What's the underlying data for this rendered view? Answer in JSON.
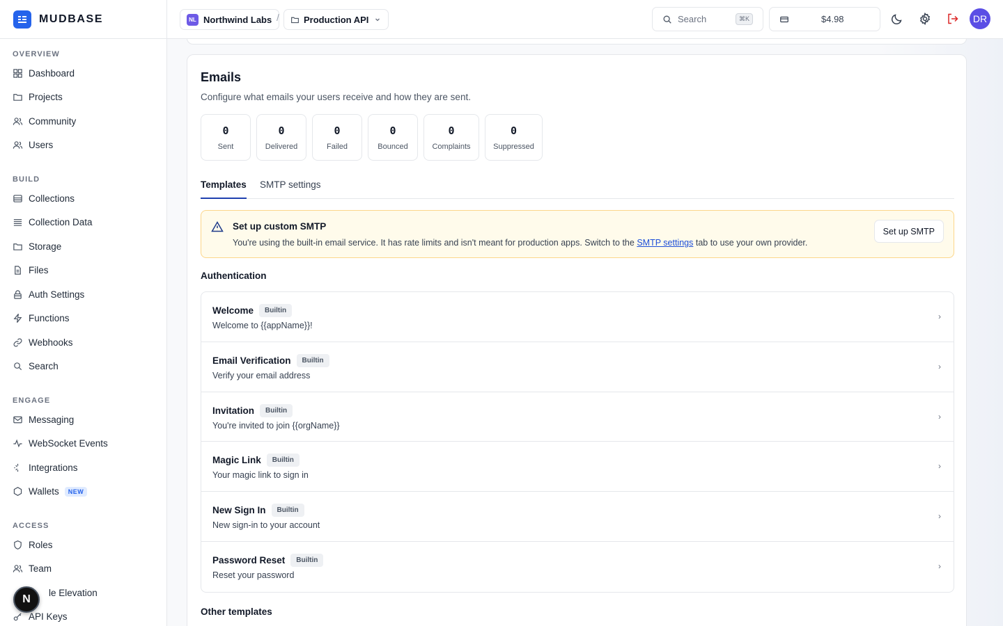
{
  "brand": {
    "name": "MUDBASE"
  },
  "sidebar": {
    "sections": [
      {
        "heading": "OVERVIEW",
        "items": [
          {
            "label": "Dashboard",
            "icon": "grid-icon"
          },
          {
            "label": "Projects",
            "icon": "folder-icon"
          },
          {
            "label": "Community",
            "icon": "users-icon"
          },
          {
            "label": "Users",
            "icon": "users-icon"
          }
        ]
      },
      {
        "heading": "BUILD",
        "items": [
          {
            "label": "Collections",
            "icon": "database-icon"
          },
          {
            "label": "Collection Data",
            "icon": "list-icon"
          },
          {
            "label": "Storage",
            "icon": "folder-icon"
          },
          {
            "label": "Files",
            "icon": "file-icon"
          },
          {
            "label": "Auth Settings",
            "icon": "lock-icon"
          },
          {
            "label": "Functions",
            "icon": "bolt-icon"
          },
          {
            "label": "Webhooks",
            "icon": "link-icon"
          },
          {
            "label": "Search",
            "icon": "search-icon"
          }
        ]
      },
      {
        "heading": "ENGAGE",
        "items": [
          {
            "label": "Messaging",
            "icon": "mail-icon"
          },
          {
            "label": "WebSocket Events",
            "icon": "activity-icon"
          },
          {
            "label": "Integrations",
            "icon": "sparkle-icon"
          },
          {
            "label": "Wallets",
            "icon": "hexagon-icon",
            "badge": "NEW"
          }
        ]
      },
      {
        "heading": "ACCESS",
        "items": [
          {
            "label": "Roles",
            "icon": "shield-icon"
          },
          {
            "label": "Team",
            "icon": "users-icon"
          },
          {
            "label": "le Elevation",
            "icon": "user-up-icon"
          },
          {
            "label": "API Keys",
            "icon": "key-icon"
          }
        ]
      }
    ],
    "fab_label": "N"
  },
  "topbar": {
    "org": {
      "initials": "NL",
      "name": "Northwind Labs"
    },
    "separator": "/",
    "project": {
      "name": "Production API"
    },
    "search": {
      "placeholder": "Search",
      "shortcut": "⌘K"
    },
    "credits": "$4.98",
    "avatar_initials": "DR"
  },
  "emails": {
    "title": "Emails",
    "subtitle": "Configure what emails your users receive and how they are sent.",
    "stats": [
      {
        "value": "0",
        "label": "Sent"
      },
      {
        "value": "0",
        "label": "Delivered"
      },
      {
        "value": "0",
        "label": "Failed"
      },
      {
        "value": "0",
        "label": "Bounced"
      },
      {
        "value": "0",
        "label": "Complaints"
      },
      {
        "value": "0",
        "label": "Suppressed"
      }
    ],
    "tabs": [
      {
        "label": "Templates",
        "active": true
      },
      {
        "label": "SMTP settings",
        "active": false
      }
    ],
    "alert": {
      "title": "Set up custom SMTP",
      "text_before": "You're using the built-in email service. It has rate limits and isn't meant for production apps. Switch to the ",
      "link": "SMTP settings",
      "text_after": " tab to use your own provider.",
      "button": "Set up SMTP"
    },
    "auth_heading": "Authentication",
    "templates": [
      {
        "name": "Welcome",
        "badge": "Builtin",
        "subject": "Welcome to {{appName}}!"
      },
      {
        "name": "Email Verification",
        "badge": "Builtin",
        "subject": "Verify your email address"
      },
      {
        "name": "Invitation",
        "badge": "Builtin",
        "subject": "You're invited to join {{orgName}}"
      },
      {
        "name": "Magic Link",
        "badge": "Builtin",
        "subject": "Your magic link to sign in"
      },
      {
        "name": "New Sign In",
        "badge": "Builtin",
        "subject": "New sign-in to your account"
      },
      {
        "name": "Password Reset",
        "badge": "Builtin",
        "subject": "Reset your password"
      }
    ],
    "other_heading": "Other templates"
  },
  "colors": {
    "accent": "#2563eb",
    "avatar": "#5b4ee5",
    "alert_bg": "#fffbeb",
    "alert_border": "#fcd68a",
    "logout": "#dc2626"
  }
}
